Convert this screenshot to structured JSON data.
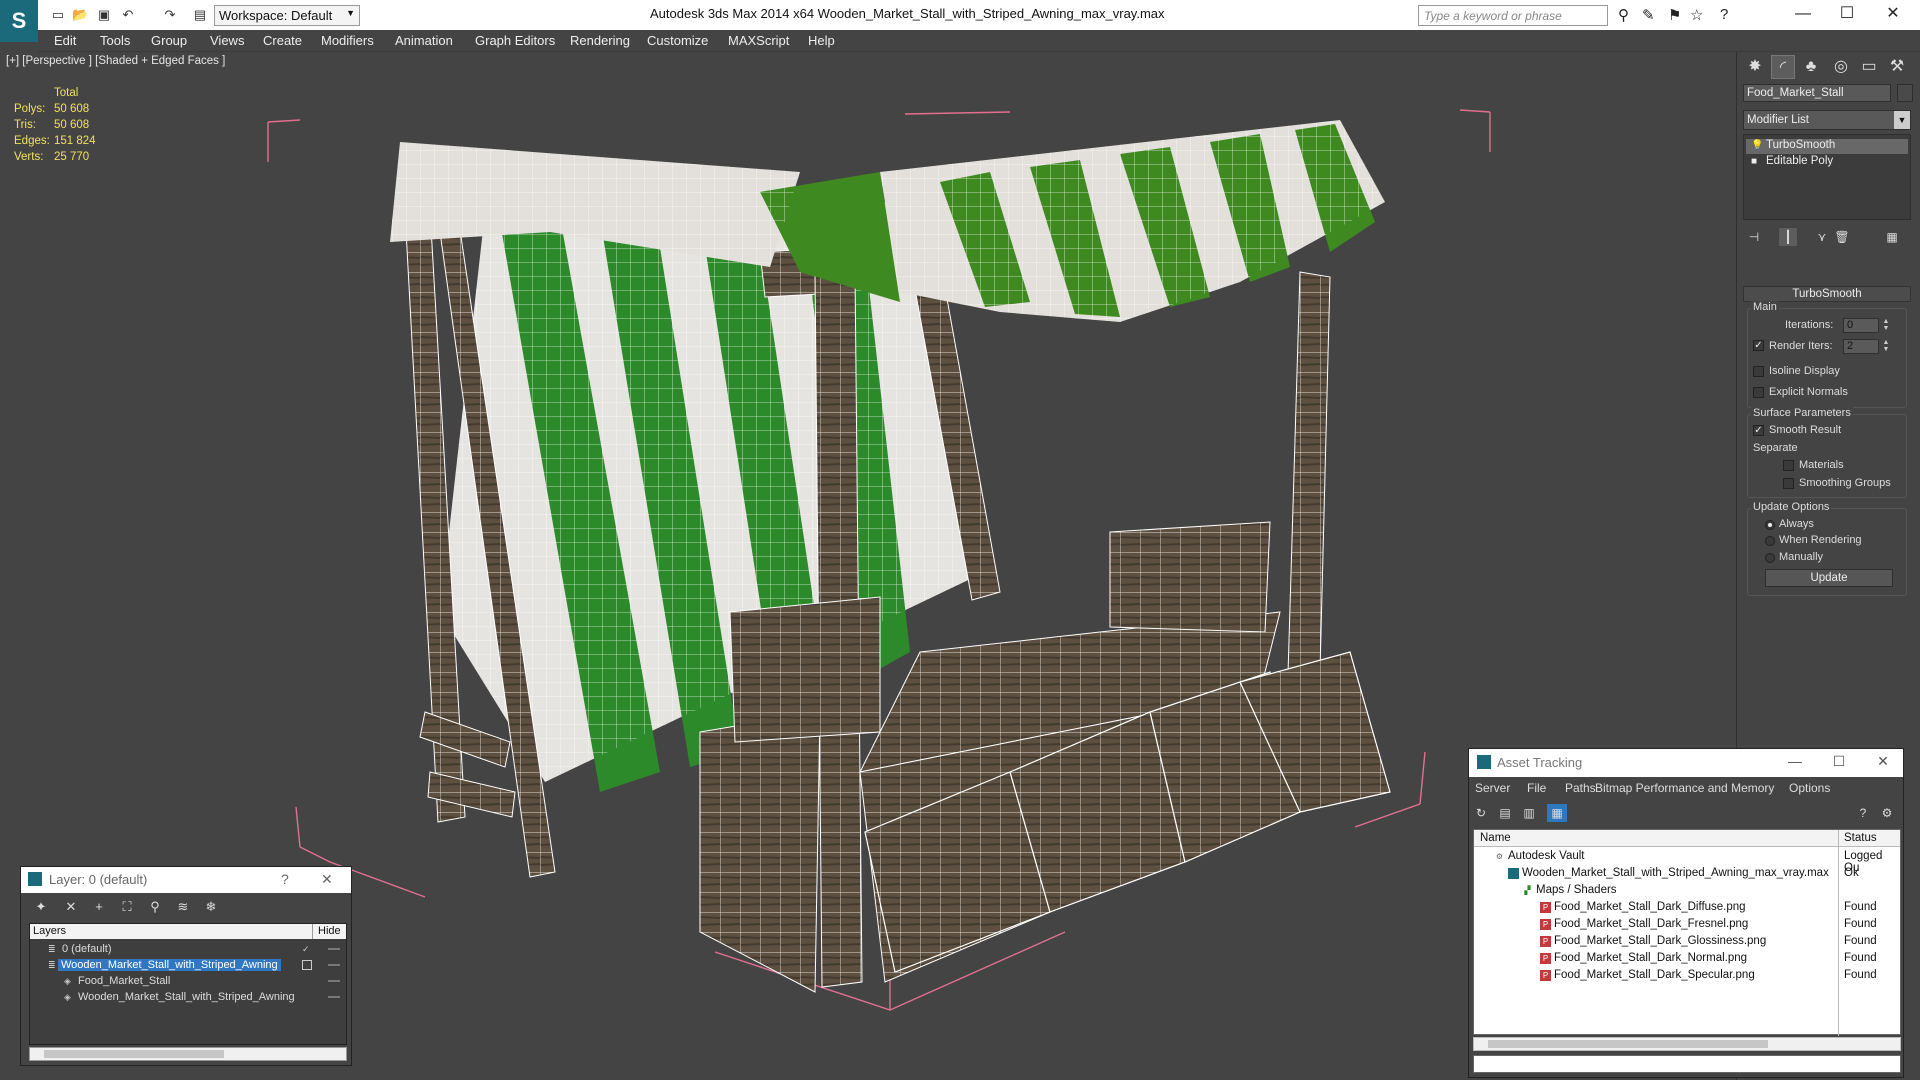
{
  "app": {
    "title": "Autodesk 3ds Max  2014 x64      Wooden_Market_Stall_with_Striped_Awning_max_vray.max",
    "workspace": "Workspace: Default",
    "search_placeholder": "Type a keyword or phrase"
  },
  "menu": [
    "Edit",
    "Tools",
    "Group",
    "Views",
    "Create",
    "Modifiers",
    "Animation",
    "Graph Editors",
    "Rendering",
    "Customize",
    "MAXScript",
    "Help"
  ],
  "viewport": {
    "label": "[+] [Perspective ] [Shaded + Edged Faces ]",
    "stats": {
      "header": "Total",
      "rows": [
        {
          "key": "Polys:",
          "value": "50 608"
        },
        {
          "key": "Tris:",
          "value": "50 608"
        },
        {
          "key": "Edges:",
          "value": "151 824"
        },
        {
          "key": "Verts:",
          "value": "25 770"
        }
      ]
    }
  },
  "command_panel": {
    "object_name": "Food_Market_Stall",
    "modifier_list": "Modifier List",
    "stack": [
      {
        "label": "TurboSmooth",
        "selected": true
      },
      {
        "label": "Editable Poly",
        "selected": false
      }
    ],
    "rollout": "TurboSmooth",
    "main_group": "Main",
    "iterations_label": "Iterations:",
    "iterations_value": "0",
    "render_iters_label": "Render Iters:",
    "render_iters_value": "2",
    "isoline_label": "Isoline Display",
    "explicit_normals_label": "Explicit Normals",
    "surface_group": "Surface Parameters",
    "smooth_result_label": "Smooth Result",
    "separate_label": "Separate",
    "materials_label": "Materials",
    "smoothing_groups_label": "Smoothing Groups",
    "update_group": "Update Options",
    "always_label": "Always",
    "when_rendering_label": "When Rendering",
    "manually_label": "Manually",
    "update_button": "Update"
  },
  "asset_tracking": {
    "title": "Asset Tracking",
    "menu": [
      "Server",
      "File",
      "Paths",
      "Bitmap Performance and Memory",
      "Options"
    ],
    "columns": {
      "name": "Name",
      "status": "Status"
    },
    "rows": [
      {
        "name": "Autodesk Vault",
        "status": "Logged Ou",
        "indent": 1,
        "icon": "vault-icon"
      },
      {
        "name": "Wooden_Market_Stall_with_Striped_Awning_max_vray.max",
        "status": "Ok",
        "indent": 2,
        "icon": "max-file-icon"
      },
      {
        "name": "Maps / Shaders",
        "status": "",
        "indent": 3,
        "icon": "maps-icon"
      },
      {
        "name": "Food_Market_Stall_Dark_Diffuse.png",
        "status": "Found",
        "indent": 4,
        "icon": "png-icon"
      },
      {
        "name": "Food_Market_Stall_Dark_Fresnel.png",
        "status": "Found",
        "indent": 4,
        "icon": "png-icon"
      },
      {
        "name": "Food_Market_Stall_Dark_Glossiness.png",
        "status": "Found",
        "indent": 4,
        "icon": "png-icon"
      },
      {
        "name": "Food_Market_Stall_Dark_Normal.png",
        "status": "Found",
        "indent": 4,
        "icon": "png-icon"
      },
      {
        "name": "Food_Market_Stall_Dark_Specular.png",
        "status": "Found",
        "indent": 4,
        "icon": "png-icon"
      }
    ]
  },
  "layer_window": {
    "title": "Layer: 0 (default)",
    "help": "?",
    "columns": {
      "name": "Layers",
      "hide": "Hide"
    },
    "rows": [
      {
        "name": "0 (default)",
        "selected": false,
        "indent": 1
      },
      {
        "name": "Wooden_Market_Stall_with_Striped_Awning",
        "selected": true,
        "indent": 1
      },
      {
        "name": "Food_Market_Stall",
        "selected": false,
        "indent": 2
      },
      {
        "name": "Wooden_Market_Stall_with_Striped_Awning",
        "selected": false,
        "indent": 2
      }
    ]
  },
  "colors": {
    "stats_yellow": "#f0e060",
    "selection_blue": "#2f77c0",
    "awning_green": "#2c8a2a",
    "bbox_pink": "#e07090"
  }
}
